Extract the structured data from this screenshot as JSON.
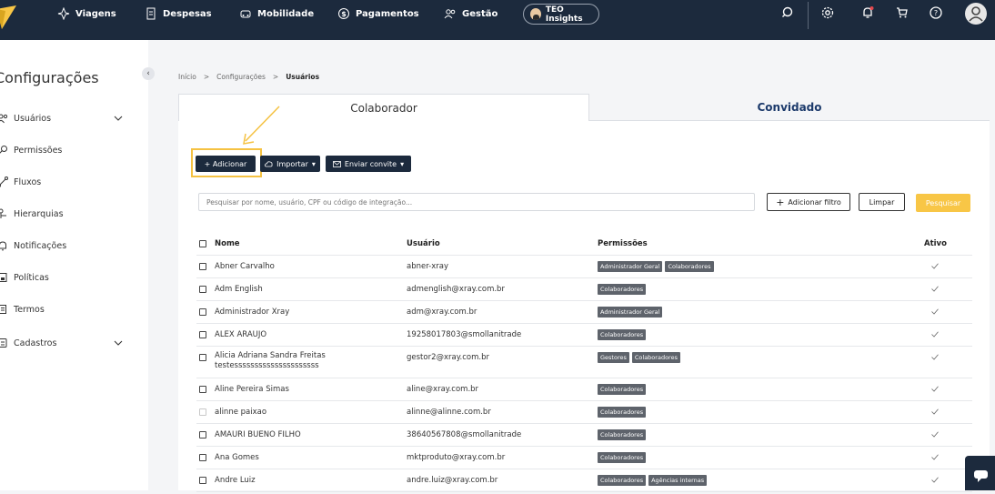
{
  "topbar": {
    "nav": [
      {
        "label": "Viagens",
        "icon": "travel-icon"
      },
      {
        "label": "Despesas",
        "icon": "receipt-icon"
      },
      {
        "label": "Mobilidade",
        "icon": "car-icon"
      },
      {
        "label": "Pagamentos",
        "icon": "dollar-icon"
      },
      {
        "label": "Gestão",
        "icon": "users-icon"
      }
    ],
    "teo_label": "TEO Insights"
  },
  "sidebar": {
    "title": "Configurações",
    "items": [
      {
        "label": "Usuários",
        "icon": "users-icon",
        "expandable": true
      },
      {
        "label": "Permissões",
        "icon": "key-icon"
      },
      {
        "label": "Fluxos",
        "icon": "flow-icon"
      },
      {
        "label": "Hierarquias",
        "icon": "hierarchy-icon"
      },
      {
        "label": "Notificações",
        "icon": "bell-icon"
      },
      {
        "label": "Políticas",
        "icon": "policy-icon"
      },
      {
        "label": "Termos",
        "icon": "document-icon"
      },
      {
        "label": "Cadastros",
        "icon": "database-icon",
        "expandable": true
      }
    ]
  },
  "breadcrumb": [
    "Início",
    "Configurações",
    "Usuários"
  ],
  "tabs": {
    "colaborador": "Colaborador",
    "convidado": "Convidado"
  },
  "actions": {
    "add": "+ Adicionar",
    "import": "Importar",
    "invite": "Enviar convite"
  },
  "search": {
    "placeholder": "Pesquisar por nome, usuário, CPF ou código de integração..."
  },
  "filters": {
    "add_filter": "Adicionar filtro",
    "clear": "Limpar",
    "search": "Pesquisar"
  },
  "table": {
    "headers": {
      "name": "Nome",
      "user": "Usuário",
      "perms": "Permissões",
      "active": "Ativo"
    },
    "rows": [
      {
        "name": "Abner Carvalho",
        "user": "abner-xray",
        "perms": [
          "Administrador Geral",
          "Colaboradores"
        ],
        "active": true
      },
      {
        "name": "Adm English",
        "user": "admenglish@xray.com.br",
        "perms": [
          "Colaboradores"
        ],
        "active": true
      },
      {
        "name": "Administrador Xray",
        "user": "adm@xray.com.br",
        "perms": [
          "Administrador Geral"
        ],
        "active": true
      },
      {
        "name": "ALEX ARAUJO",
        "user": "19258017803@smollanitrade",
        "perms": [
          "Colaboradores"
        ],
        "active": true
      },
      {
        "name": "Alicia Adriana Sandra Freitas",
        "name2": "testesssssssssssssssssssss",
        "user": "gestor2@xray.com.br",
        "perms": [
          "Gestores",
          "Colaboradores"
        ],
        "active": true
      },
      {
        "name": "Aline Pereira Simas",
        "user": "aline@xray.com.br",
        "perms": [
          "Colaboradores"
        ],
        "active": true
      },
      {
        "name": "alinne paixao",
        "user": "alinne@alinne.com.br",
        "perms": [
          "Colaboradores"
        ],
        "active": true,
        "disabled": true
      },
      {
        "name": "AMAURI BUENO FILHO",
        "user": "38640567808@smollanitrade",
        "perms": [
          "Colaboradores"
        ],
        "active": true
      },
      {
        "name": "Ana Gomes",
        "user": "mktproduto@xray.com.br",
        "perms": [
          "Colaboradores"
        ],
        "active": true
      },
      {
        "name": "Andre Luiz",
        "user": "andre.luiz@xray.com.br",
        "perms": [
          "Colaboradores",
          "Agências internas"
        ],
        "active": true
      }
    ]
  },
  "colors": {
    "navy": "#1c2a3d",
    "accent": "#f8c646",
    "tag": "#5e636b"
  }
}
